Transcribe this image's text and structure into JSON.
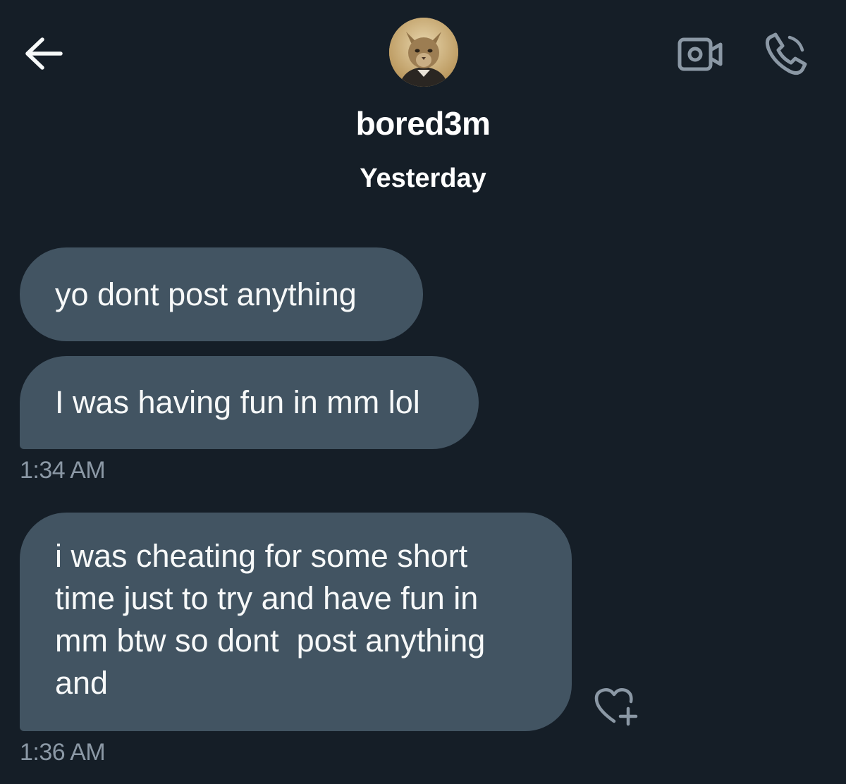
{
  "header": {
    "username": "bored3m",
    "back_icon": "arrow-left-icon",
    "video_icon": "video-camera-icon",
    "phone_icon": "phone-icon",
    "avatar": "cat-avatar"
  },
  "date_divider": "Yesterday",
  "messages": [
    {
      "text": "yo dont post anything"
    },
    {
      "text": "I was having fun in mm lol"
    },
    {
      "lines": [
        "i was cheating for some short",
        "time just to try and have fun in",
        "mm btw so dont  post anything",
        "and"
      ]
    }
  ],
  "timestamps": [
    "1:34 AM",
    "1:36 AM"
  ],
  "react_icon": "heart-plus-icon",
  "colors": {
    "background": "#151e27",
    "bubble": "#425462",
    "text": "#f7f9f9",
    "muted": "#8b98a5"
  }
}
